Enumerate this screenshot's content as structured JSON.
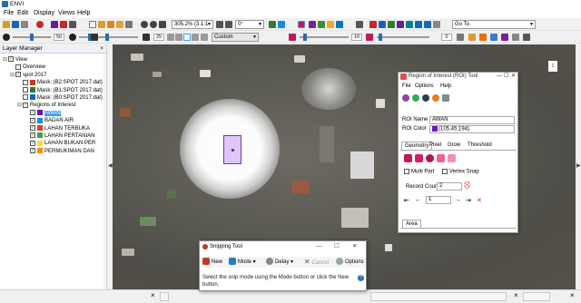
{
  "window": {
    "title": "ENVI"
  },
  "menu": [
    "File",
    "Edit",
    "Display",
    "Views",
    "Help"
  ],
  "toolbar": {
    "zoom_value": "305.2% (3.1:1",
    "rotate_value": "0°",
    "goto_value": "Go To",
    "stretch_value": "Custom",
    "brightness_value": "50",
    "contrast_value": "25",
    "sharpen_value": "10",
    "transparency_value": "0",
    "colors": {
      "accent": "#2b6cb0"
    }
  },
  "layer_manager": {
    "title": "Layer Manager",
    "close": "×",
    "items": [
      {
        "label": "View",
        "indent": 0,
        "toggle": "⊟",
        "checked": true,
        "swatch": ""
      },
      {
        "label": "Overview",
        "indent": 1,
        "toggle": "",
        "checked": false,
        "swatch": ""
      },
      {
        "label": "spot 2017",
        "indent": 1,
        "toggle": "⊟",
        "checked": true,
        "swatch": ""
      },
      {
        "label": "Mask: (B2:SPOT 2017.dat) (",
        "indent": 2,
        "toggle": "",
        "checked": false,
        "swatch": "#c0392b"
      },
      {
        "label": "Mask: (B1:SPOT 2017.dat) (",
        "indent": 2,
        "toggle": "",
        "checked": false,
        "swatch": "#2e7d32"
      },
      {
        "label": "Mask: (B0:SPOT 2017.dat) (",
        "indent": 2,
        "toggle": "",
        "checked": false,
        "swatch": "#1565c0"
      },
      {
        "label": "Regions of Interest",
        "indent": 2,
        "toggle": "⊟",
        "checked": true,
        "swatch": ""
      },
      {
        "label": "AWAN",
        "indent": 3,
        "toggle": "",
        "checked": true,
        "swatch": "#6915c2",
        "selected": true
      },
      {
        "label": "BADAN AIR",
        "indent": 3,
        "toggle": "",
        "checked": true,
        "swatch": "#1e88e5"
      },
      {
        "label": "LAHAN TERBUKA",
        "indent": 3,
        "toggle": "",
        "checked": true,
        "swatch": "#e53935"
      },
      {
        "label": "LAHAN PERTANIAN",
        "indent": 3,
        "toggle": "",
        "checked": true,
        "swatch": "#43a047"
      },
      {
        "label": "LAHAN BUKAN PER",
        "indent": 3,
        "toggle": "",
        "checked": true,
        "swatch": "#fdd835"
      },
      {
        "label": "PERMUKIMAN DAN",
        "indent": 3,
        "toggle": "",
        "checked": true,
        "swatch": "#fb8c00"
      }
    ]
  },
  "roi_tool": {
    "title": "Region of Interest (ROI) Tool",
    "menu": [
      "File",
      "Options",
      "Help"
    ],
    "roi_name_label": "ROI Name",
    "roi_name": "AWAN",
    "roi_color_label": "ROI Color",
    "roi_color": "(105,45,194)",
    "swatch_color": "#6915c2",
    "tabs": [
      "Geometry",
      "Pixel",
      "Grow",
      "Threshold"
    ],
    "active_tab": "Geometry",
    "multi_part": "Multi Part",
    "vertex_snap": "Vertex Snap",
    "record_count_label": "Record Count",
    "record_count": "2",
    "record_index": "1",
    "area_tab": "Area"
  },
  "snipping_tool": {
    "title": "Snipping Tool",
    "new": "New",
    "mode": "Mode",
    "delay": "Delay",
    "cancel": "Cancel",
    "options": "Options",
    "message": "Select the snip mode using the Mode button or click the New button.",
    "help": "?"
  },
  "statusbar": {
    "close_glyph": "×"
  }
}
